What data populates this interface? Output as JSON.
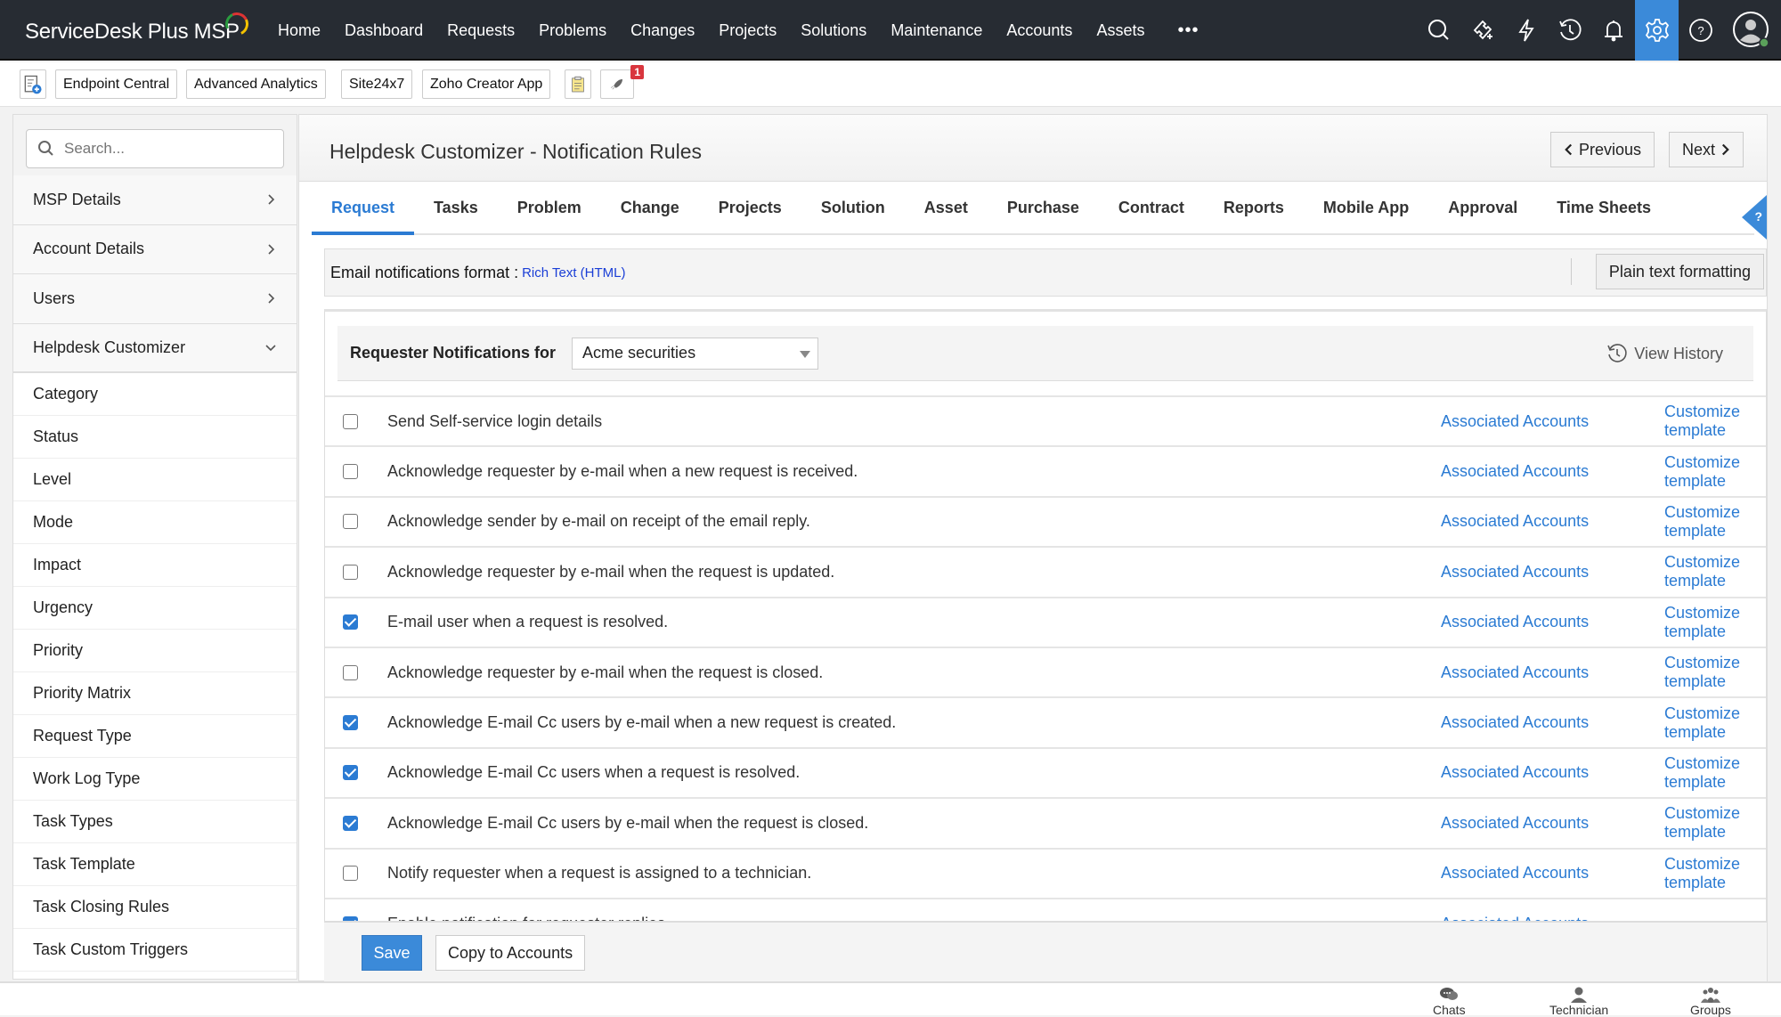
{
  "app": {
    "title": "ServiceDesk Plus MSP"
  },
  "nav": {
    "items": [
      "Home",
      "Dashboard",
      "Requests",
      "Problems",
      "Changes",
      "Projects",
      "Solutions",
      "Maintenance",
      "Accounts",
      "Assets"
    ],
    "more": "•••"
  },
  "top_icons": [
    "search-icon",
    "ticket-add-icon",
    "quick-action-icon",
    "history-icon",
    "notification-bell-icon",
    "settings-gear-icon",
    "help-icon",
    "user-avatar-icon"
  ],
  "toolbar": {
    "buttons": [
      "Endpoint Central",
      "Advanced Analytics",
      "Site24x7",
      "Zoho Creator App"
    ],
    "notification_badge": "1"
  },
  "sidebar": {
    "search_placeholder": "Search...",
    "main_items": [
      {
        "label": "MSP Details",
        "expanded": false
      },
      {
        "label": "Account Details",
        "expanded": false
      },
      {
        "label": "Users",
        "expanded": false
      },
      {
        "label": "Helpdesk Customizer",
        "expanded": true
      }
    ],
    "sub_items": [
      "Category",
      "Status",
      "Level",
      "Mode",
      "Impact",
      "Urgency",
      "Priority",
      "Priority Matrix",
      "Request Type",
      "Work Log Type",
      "Task Types",
      "Task Template",
      "Task Closing Rules",
      "Task Custom Triggers"
    ]
  },
  "page": {
    "title": "Helpdesk Customizer - Notification Rules",
    "previous_label": "Previous",
    "next_label": "Next",
    "help_label": "?"
  },
  "tabs": [
    {
      "label": "Request",
      "active": true
    },
    {
      "label": "Tasks"
    },
    {
      "label": "Problem"
    },
    {
      "label": "Change"
    },
    {
      "label": "Projects"
    },
    {
      "label": "Solution"
    },
    {
      "label": "Asset"
    },
    {
      "label": "Purchase"
    },
    {
      "label": "Contract"
    },
    {
      "label": "Reports"
    },
    {
      "label": "Mobile App"
    },
    {
      "label": "Approval"
    },
    {
      "label": "Time Sheets"
    }
  ],
  "format": {
    "label": "Email notifications format :",
    "value": "Rich Text (HTML)",
    "plain_button": "Plain text formatting"
  },
  "notifications": {
    "filter_label": "Requester Notifications for",
    "account_selected": "Acme securities",
    "view_history": "View History",
    "associated_label": "Associated Accounts",
    "customize_label": "Customize template",
    "rules": [
      {
        "text": "Send Self-service login details",
        "checked": false,
        "customize": true
      },
      {
        "text": "Acknowledge requester by e-mail when a new request is received.",
        "checked": false,
        "customize": true
      },
      {
        "text": "Acknowledge sender by e-mail on receipt of the email reply.",
        "checked": false,
        "customize": true
      },
      {
        "text": "Acknowledge requester by e-mail when the request is updated.",
        "checked": false,
        "customize": true
      },
      {
        "text": "E-mail user when a request is resolved.",
        "checked": true,
        "customize": true
      },
      {
        "text": "Acknowledge requester by e-mail when the request is closed.",
        "checked": false,
        "customize": true
      },
      {
        "text": "Acknowledge E-mail Cc users by e-mail when a new request is created.",
        "checked": true,
        "customize": true
      },
      {
        "text": "Acknowledge E-mail Cc users when a request is resolved.",
        "checked": true,
        "customize": true
      },
      {
        "text": "Acknowledge E-mail Cc users by e-mail when the request is closed.",
        "checked": true,
        "customize": true
      },
      {
        "text": "Notify requester when a request is assigned to a technician.",
        "checked": false,
        "customize": true
      },
      {
        "text": "Enable notification for requester replies",
        "checked": true,
        "customize": false
      }
    ]
  },
  "footer": {
    "save": "Save",
    "copy": "Copy to Accounts"
  },
  "bottom_bar": {
    "items": [
      "Chats",
      "Technician",
      "Groups"
    ]
  },
  "colors": {
    "accent": "#3b8ad9",
    "header_bg": "#272c33",
    "link": "#2b7bd3"
  }
}
